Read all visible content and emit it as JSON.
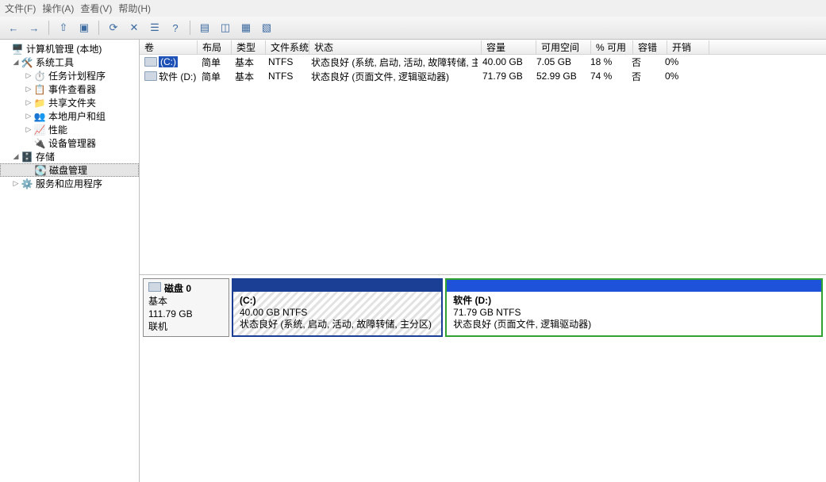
{
  "menu": {
    "file": "文件(F)",
    "action": "操作(A)",
    "view": "查看(V)",
    "help": "帮助(H)"
  },
  "toolbar": {
    "back": "←",
    "fwd": "→",
    "up": "⇧",
    "folders": "▣",
    "refresh": "⟳",
    "delete": "✕",
    "props": "☰",
    "help": "?",
    "i1": "▤",
    "i2": "◫",
    "i3": "▦",
    "i4": "▧"
  },
  "tree": {
    "root": "计算机管理 (本地)",
    "systools": "系统工具",
    "tasks": "任务计划程序",
    "events": "事件查看器",
    "shared": "共享文件夹",
    "users": "本地用户和组",
    "perf": "性能",
    "devmgr": "设备管理器",
    "storage": "存储",
    "diskmgr": "磁盘管理",
    "svc": "服务和应用程序"
  },
  "columns": {
    "vol": "卷",
    "layout": "布局",
    "type": "类型",
    "fs": "文件系统",
    "status": "状态",
    "cap": "容量",
    "free": "可用空间",
    "pct": "% 可用",
    "fault": "容错",
    "overhead": "开销"
  },
  "vols": [
    {
      "name": "(C:)",
      "layout": "简单",
      "type": "基本",
      "fs": "NTFS",
      "status": "状态良好 (系统, 启动, 活动, 故障转储, 主分区)",
      "cap": "40.00 GB",
      "free": "7.05 GB",
      "pct": "18 %",
      "fault": "否",
      "oh": "0%"
    },
    {
      "name": "软件 (D:)",
      "layout": "简单",
      "type": "基本",
      "fs": "NTFS",
      "status": "状态良好 (页面文件, 逻辑驱动器)",
      "cap": "71.79 GB",
      "free": "52.99 GB",
      "pct": "74 %",
      "fault": "否",
      "oh": "0%"
    }
  ],
  "disk": {
    "label": "磁盘 0",
    "type": "基本",
    "size": "111.79 GB",
    "state": "联机",
    "parts": [
      {
        "title": "(C:)",
        "line2": "40.00 GB NTFS",
        "line3": "状态良好 (系统, 启动, 活动, 故障转储, 主分区)"
      },
      {
        "title": "软件  (D:)",
        "line2": "71.79 GB NTFS",
        "line3": "状态良好 (页面文件, 逻辑驱动器)"
      }
    ]
  }
}
